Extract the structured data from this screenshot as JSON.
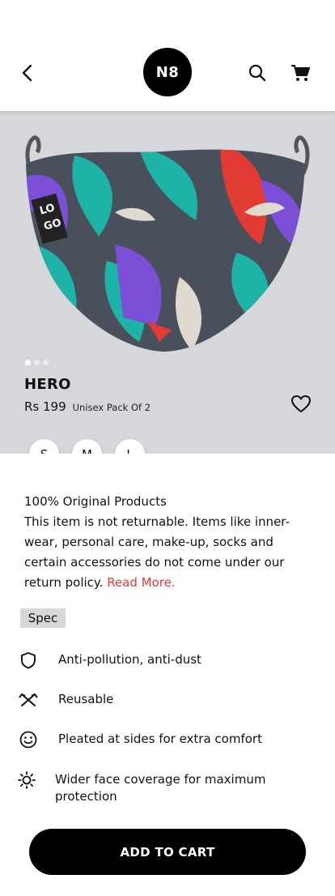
{
  "header": {
    "logo_text": "N8",
    "back_icon": "chevron-left-icon",
    "search_icon": "search-icon",
    "cart_icon": "cart-icon"
  },
  "gallery": {
    "image_alt": "patterned face mask",
    "logo_on_product": "LOGO",
    "slide_count": 3,
    "active_slide": 1
  },
  "product": {
    "name": "HERO",
    "price": "Rs 199",
    "pack": "Unisex Pack Of 2",
    "wishlist_icon": "heart-outline-icon"
  },
  "sizes": [
    "S",
    "M",
    "L"
  ],
  "info": {
    "heading": "100% Original Products",
    "body": "This item is not returnable. Items like inner-wear, personal care, make-up, socks and certain accessories do not come under our return policy.",
    "read_more": "Read More."
  },
  "spec_label": "Spec",
  "features": [
    {
      "icon": "shield-icon",
      "text": "Anti-pollution, anti-dust"
    },
    {
      "icon": "recycle-arrows-icon",
      "text": "Reusable"
    },
    {
      "icon": "smile-icon",
      "text": "Pleated at sides for extra comfort"
    },
    {
      "icon": "sun-icon",
      "text": "Wider face coverage for maximum protection"
    }
  ],
  "cta": {
    "label": "ADD TO CART"
  },
  "colors": {
    "accent": "#e53935",
    "hero_bg": "#d5d7db",
    "button": "#000000"
  }
}
